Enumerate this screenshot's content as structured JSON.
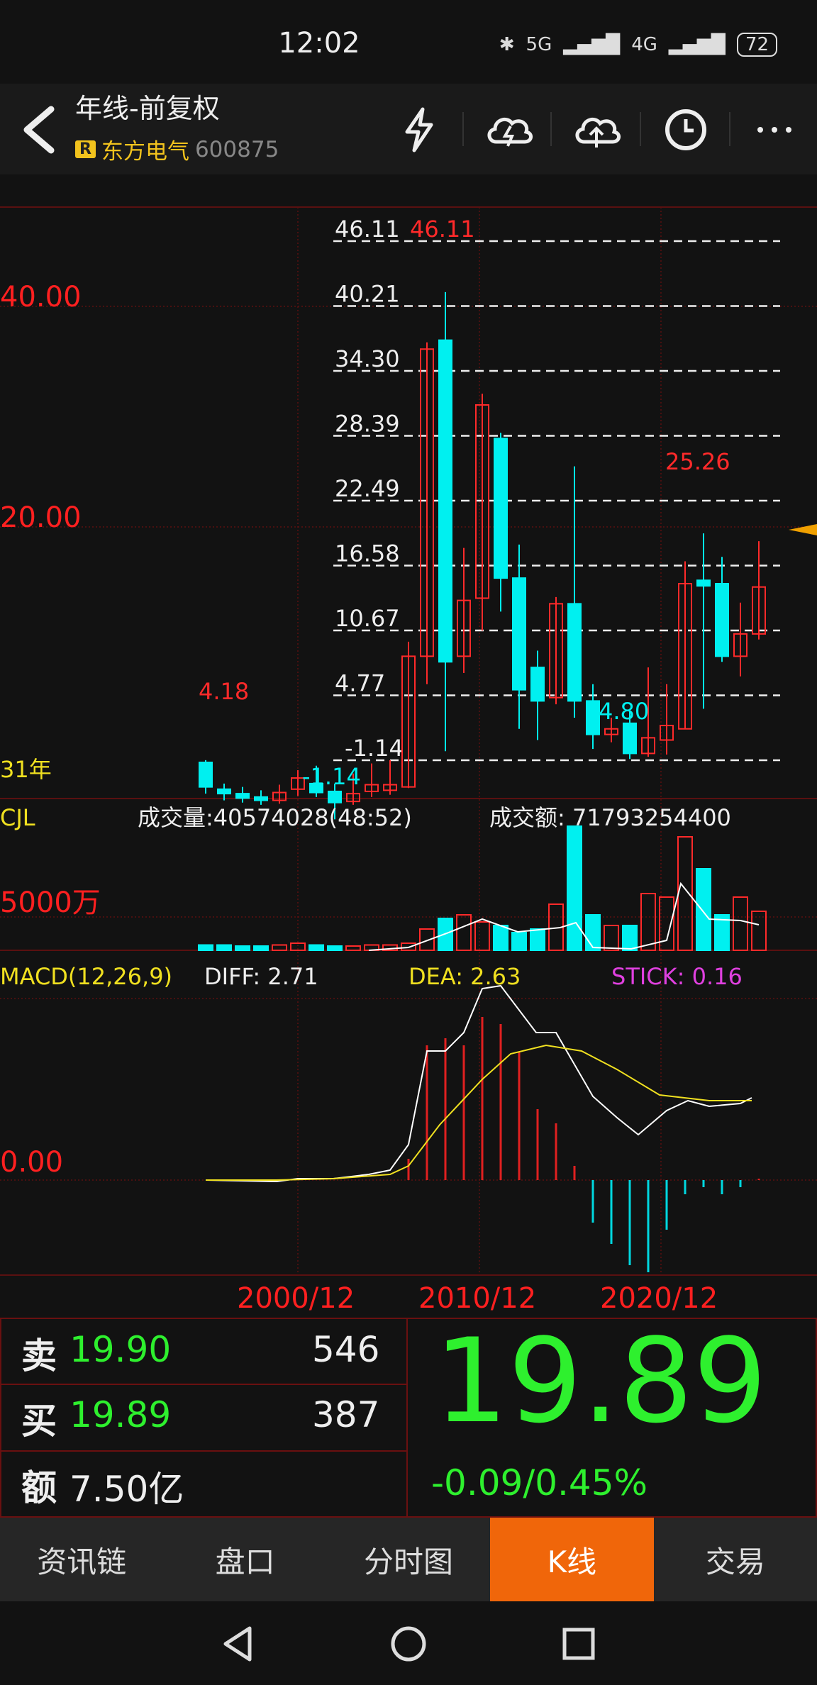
{
  "status_bar": {
    "time": "12:02",
    "signal_5g": "5G",
    "signal_4g": "4G",
    "battery": "72"
  },
  "header": {
    "title": "年线-前复权",
    "badge": "R",
    "stock_name": "东方电气",
    "stock_code": "600875",
    "icons": [
      "lightning-icon",
      "cloud-download-icon",
      "cloud-upload-icon",
      "clock-icon",
      "more-icon"
    ]
  },
  "price_chart": {
    "left_labels": [
      "40.00",
      "20.00"
    ],
    "period_label": "31年",
    "fib_levels": [
      "46.11",
      "40.21",
      "34.30",
      "28.39",
      "22.49",
      "16.58",
      "10.67",
      "4.77",
      "-1.14"
    ],
    "high_marker": "46.11",
    "annotations": [
      "4.18",
      "25.26",
      "4.80",
      "-1.14"
    ],
    "colors": {
      "up": "#ff2a2a",
      "down": "#00f0f0",
      "grid": "#5a1010",
      "level_line": "#eeeeee",
      "pointer": "#f0a000"
    }
  },
  "volume_chart": {
    "label": "CJL",
    "volume_text": "成交量:40574028(48:52)",
    "turnover_text": "成交额: 71793254400",
    "axis_label": "5000万"
  },
  "macd_chart": {
    "label": "MACD(12,26,9)",
    "diff": "DIFF: 2.71",
    "dea": "DEA: 2.63",
    "stick": "STICK: 0.16",
    "zero_label": "0.00",
    "colors": {
      "diff": "#ffffff",
      "dea": "#f0e020",
      "stick": "#e040e0"
    }
  },
  "x_axis": [
    "2000/12",
    "2010/12",
    "2020/12"
  ],
  "quote_panel": {
    "sell_label": "卖",
    "sell_price": "19.90",
    "sell_qty": "546",
    "buy_label": "买",
    "buy_price": "19.89",
    "buy_qty": "387",
    "amount_label": "额",
    "amount_value": "7.50亿",
    "last_price": "19.89",
    "change": "-0.09/0.45%"
  },
  "tabs": [
    {
      "label": "资讯链",
      "active": false
    },
    {
      "label": "盘口",
      "active": false
    },
    {
      "label": "分时图",
      "active": false
    },
    {
      "label": "K线",
      "active": true
    },
    {
      "label": "交易",
      "active": false
    }
  ]
}
